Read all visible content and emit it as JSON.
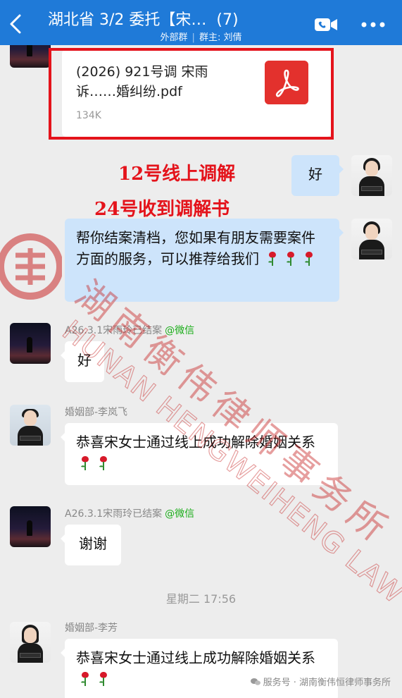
{
  "header": {
    "title": "湖北省 3/2 委托【宋",
    "title_suffix": "…",
    "count": "(7)",
    "group_type": "外部群",
    "owner": "群主: 刘倩"
  },
  "file_message": {
    "name": "(2026) 921号调 宋雨\n诉……婚纠纷.pdf",
    "size": "134K"
  },
  "overlay_notes": {
    "line1": "12号线上调解",
    "line2": "24号收到调解书"
  },
  "messages": [
    {
      "side": "right",
      "text": "好"
    },
    {
      "side": "right",
      "text": "帮你结案清档，您如果有朋友需要案件方面的服务，可以推荐给我们"
    },
    {
      "side": "left",
      "sender": "A26.3.1宋雨玲已结案",
      "sender_tag": "@微信",
      "text": "好"
    },
    {
      "side": "left",
      "sender": "婚姻部-李岚飞",
      "text": "恭喜宋女士通过线上成功解除婚姻关系"
    },
    {
      "side": "left",
      "sender": "A26.3.1宋雨玲已结案",
      "sender_tag": "@微信",
      "text": "谢谢"
    },
    {
      "side": "left",
      "sender": "婚姻部-李芳",
      "text": "恭喜宋女士通过线上成功解除婚姻关系"
    }
  ],
  "timestamp": "星期二 17:56",
  "watermark": {
    "cn": "湖南衡伟律师事务所",
    "en": "HUNAN HENGWEIHENG LAW FIRM"
  },
  "footer": {
    "label": "服务号 · 湖南衡伟恒律师事务所"
  },
  "colors": {
    "header_bg": "#1f7ad8",
    "highlight_red": "#e4131b",
    "self_bubble": "#cde4fb",
    "chat_bg": "#ededed"
  }
}
